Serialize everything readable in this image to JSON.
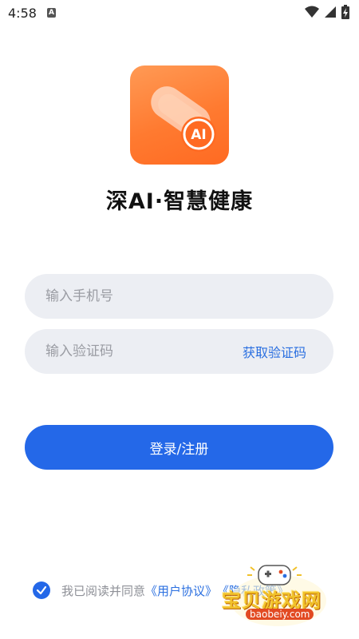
{
  "status_bar": {
    "time": "4:58",
    "notification_badge": "A",
    "icons": [
      "wifi-icon",
      "signal-icon",
      "battery-charging-icon"
    ]
  },
  "app": {
    "logo_badge": "AI",
    "title": "深AI·智慧健康"
  },
  "form": {
    "phone_placeholder": "输入手机号",
    "code_placeholder": "输入验证码",
    "get_code_label": "获取验证码",
    "submit_label": "登录/注册"
  },
  "agreement": {
    "checked": true,
    "prefix": "我已阅读并同意",
    "user_agreement": "《用户协议》",
    "privacy_policy": "《隐私政策》"
  },
  "watermark": {
    "name": "宝贝游戏网",
    "url": "baobeiy.com"
  },
  "colors": {
    "accent": "#2468e8",
    "logo_orange": "#ff7a30",
    "field_bg": "#eceef3"
  }
}
